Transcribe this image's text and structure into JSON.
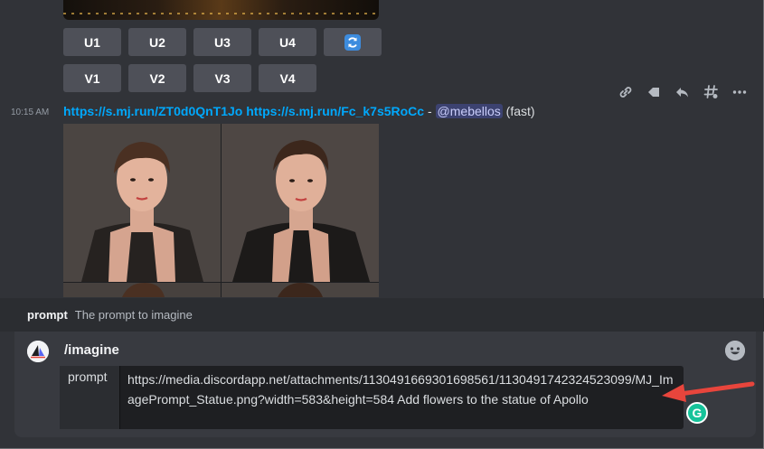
{
  "buttons": {
    "row1": [
      "U1",
      "U2",
      "U3",
      "U4"
    ],
    "refresh_icon": "refresh-icon",
    "row2": [
      "V1",
      "V2",
      "V3",
      "V4"
    ]
  },
  "toolbar": {
    "icons": [
      "link-icon",
      "tag-icon",
      "reply-icon",
      "thread-icon",
      "more-icon"
    ]
  },
  "message": {
    "timestamp": "10:15 AM",
    "link1": "https://s.mj.run/ZT0d0QnT1Jo",
    "link2": "https://s.mj.run/Fc_k7s5RoCc",
    "separator": " - ",
    "mention": "@mebellos",
    "mode": "(fast)"
  },
  "slash_command": {
    "option_name": "prompt",
    "option_description": "The prompt to imagine",
    "command": "/imagine",
    "param_label": "prompt",
    "param_value": "https://media.discordapp.net/attachments/1130491669301698561/1130491742324523099/MJ_ImagePrompt_Statue.png?width=583&height=584 Add flowers to the statue of Apollo"
  },
  "colors": {
    "background": "#313338",
    "button": "#4e5058",
    "link": "#00a8fc",
    "mention_bg": "#3c4270",
    "annotation_arrow": "#e8453c",
    "grammarly": "#15c39a"
  },
  "grammarly_badge": "G"
}
